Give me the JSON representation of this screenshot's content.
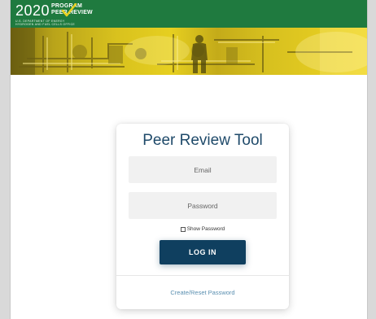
{
  "header": {
    "logo_year": "2020",
    "logo_line1": "PROGRAM",
    "logo_line2": "PEER REVIEW",
    "logo_subtext_line1": "U.S. DEPARTMENT OF ENERGY",
    "logo_subtext_line2": "HYDROGEN AND FUEL CELLS OFFICE",
    "brand_green": "#1f7a3f",
    "accent_yellow": "#e6cf20"
  },
  "banner": {
    "description_icon": "industrial-facility-banner"
  },
  "login": {
    "title": "Peer Review Tool",
    "email_placeholder": "Email",
    "password_placeholder": "Password",
    "show_password_label": "Show Password",
    "login_button_label": "LOG IN",
    "reset_link_label": "Create/Reset Password",
    "button_color": "#0f3f5f",
    "title_color": "#1f4a6a",
    "link_color": "#5a8fb0"
  }
}
